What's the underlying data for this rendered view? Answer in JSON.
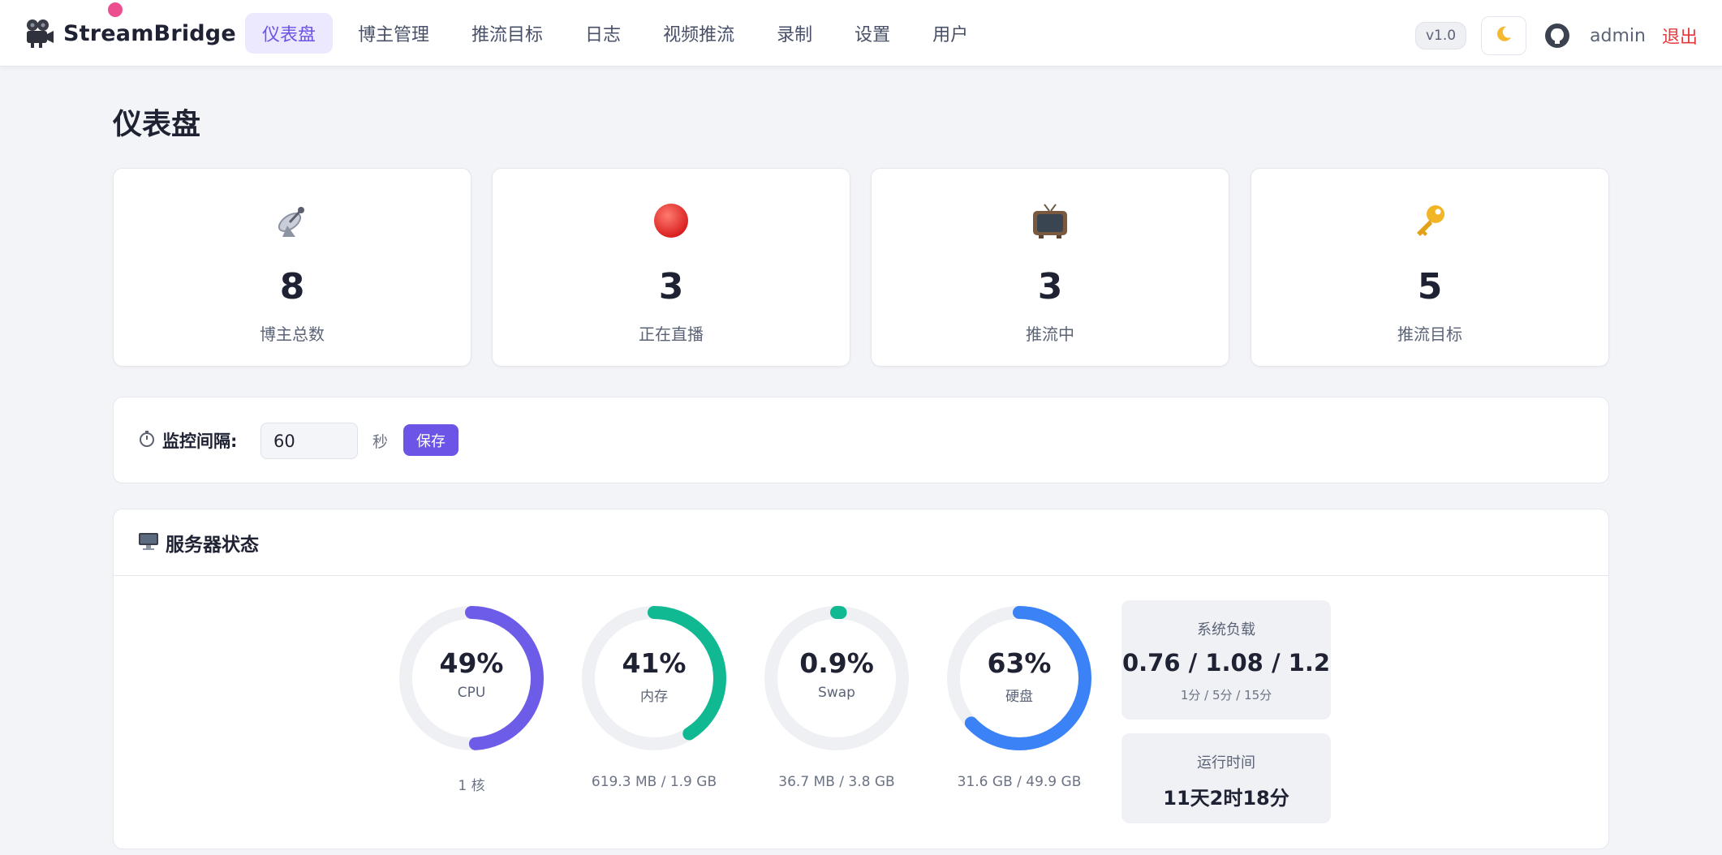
{
  "app": {
    "name": "StreamBridge",
    "version": "v1.0"
  },
  "nav": {
    "items": [
      {
        "label": "仪表盘",
        "active": true
      },
      {
        "label": "博主管理"
      },
      {
        "label": "推流目标"
      },
      {
        "label": "日志"
      },
      {
        "label": "视频推流"
      },
      {
        "label": "录制"
      },
      {
        "label": "设置"
      },
      {
        "label": "用户"
      }
    ]
  },
  "user": {
    "name": "admin",
    "logout_label": "退出"
  },
  "page": {
    "title": "仪表盘"
  },
  "stats": [
    {
      "icon": "satellite-antenna-icon",
      "value": "8",
      "label": "博主总数"
    },
    {
      "icon": "red-circle-icon",
      "value": "3",
      "label": "正在直播"
    },
    {
      "icon": "television-icon",
      "value": "3",
      "label": "推流中"
    },
    {
      "icon": "key-icon",
      "value": "5",
      "label": "推流目标"
    }
  ],
  "monitor": {
    "label": "监控间隔:",
    "value": "60",
    "unit": "秒",
    "save_label": "保存"
  },
  "server": {
    "title": "服务器状态",
    "gauges": [
      {
        "name": "CPU",
        "percent": 49,
        "display": "49%",
        "detail": "1 核",
        "color": "#6c5ce7"
      },
      {
        "name": "内存",
        "percent": 41,
        "display": "41%",
        "detail": "619.3 MB / 1.9 GB",
        "color": "#10b991"
      },
      {
        "name": "Swap",
        "percent": 0.9,
        "display": "0.9%",
        "detail": "36.7 MB / 3.8 GB",
        "color": "#10b991"
      },
      {
        "name": "硬盘",
        "percent": 63,
        "display": "63%",
        "detail": "31.6 GB / 49.9 GB",
        "color": "#3b82f6"
      }
    ],
    "load": {
      "label": "系统负载",
      "value": "0.76 / 1.08 / 1.2",
      "sub": "1分 / 5分 / 15分"
    },
    "uptime": {
      "label": "运行时间",
      "value": "11天2时18分"
    }
  },
  "colors": {
    "accent": "#6b54e6",
    "danger": "#e5383b",
    "track": "#eff0f4"
  }
}
